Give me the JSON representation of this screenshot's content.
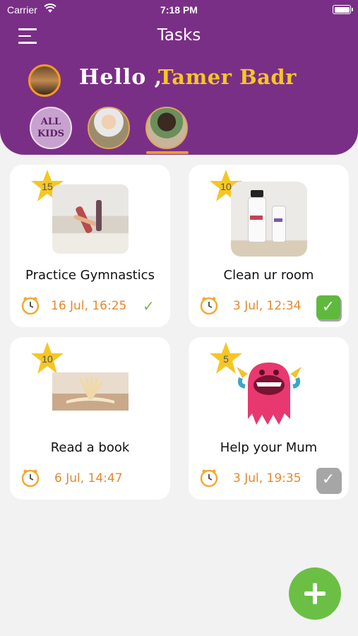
{
  "status_bar": {
    "carrier": "Carrier",
    "time": "7:18 PM"
  },
  "header": {
    "title": "Tasks",
    "greeting": "Hello ,",
    "user_name": "Tamer Badr",
    "kids": [
      {
        "label": "ALL KIDS",
        "label_line1": "ALL",
        "label_line2": "KIDS"
      },
      {
        "label": "kid-1"
      },
      {
        "label": "kid-2",
        "selected": true
      }
    ],
    "accent_color": "#7a2f86",
    "highlight_color": "#f6c623"
  },
  "tasks": [
    {
      "points": "15",
      "title": "Practice Gymnastics",
      "due": "16 Jul, 16:25",
      "status": "done-check",
      "image": "gymnastics-photo"
    },
    {
      "points": "10",
      "title": "Clean ur room",
      "due": "3 Jul, 12:34",
      "status": "checked-box-green",
      "image": "cleaning-spray-photo"
    },
    {
      "points": "10",
      "title": "Read a book",
      "due": "6 Jul, 14:47",
      "status": "none",
      "image": "open-book-photo"
    },
    {
      "points": "5",
      "title": "Help your Mum",
      "due": "3 Jul, 19:35",
      "status": "checked-box-grey",
      "image": "pink-monster-illustration"
    }
  ],
  "icons": {
    "check": "✓"
  },
  "fab": {
    "icon": "plus-icon",
    "color": "#6cbf45"
  }
}
